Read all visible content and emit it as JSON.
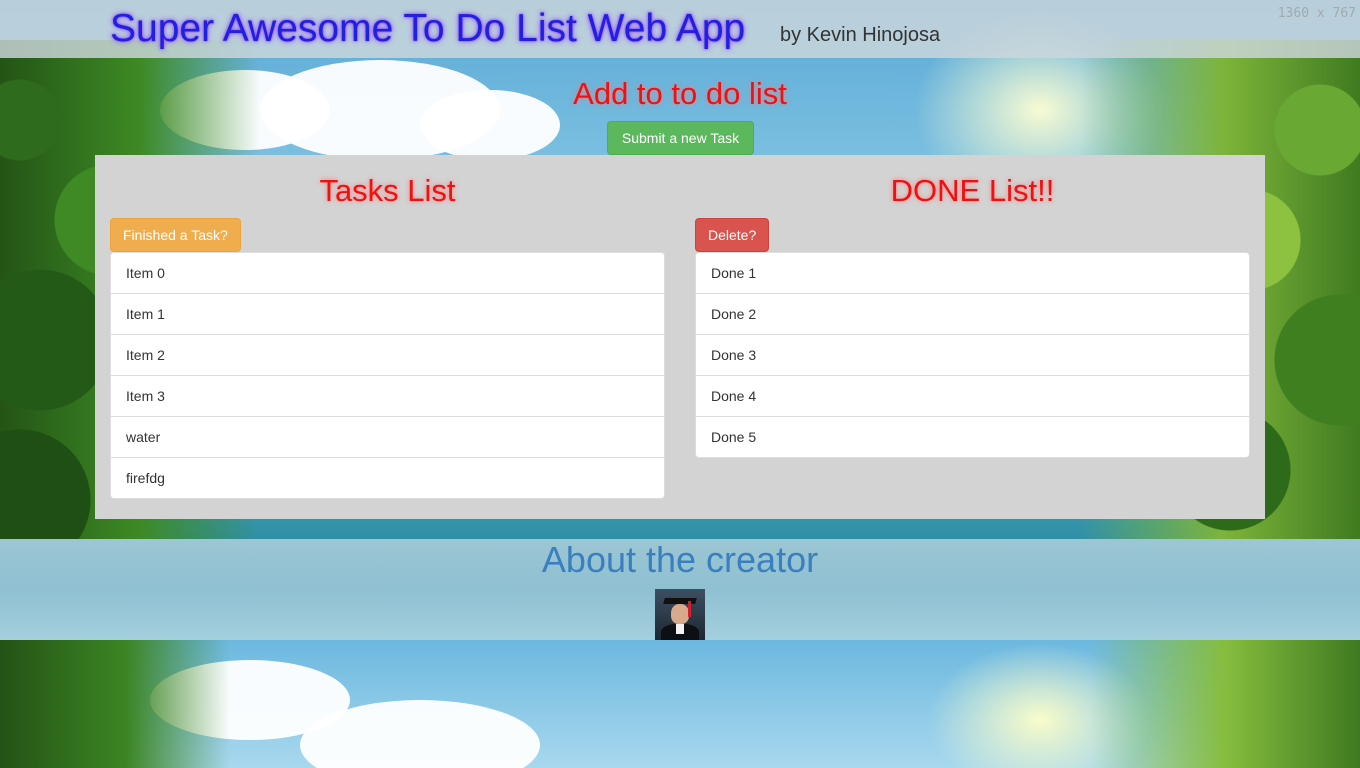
{
  "header": {
    "title": "Super Awesome To Do List Web App",
    "author": "by Kevin Hinojosa",
    "resolution_label": "1360 x 767"
  },
  "add_section": {
    "title": "Add to to do list",
    "submit_label": "Submit a new Task"
  },
  "tasks": {
    "title": "Tasks List",
    "button_label": "Finished a Task?",
    "items": [
      "Item 0",
      "Item 1",
      "Item 2",
      "Item 3",
      "water",
      "firefdg"
    ]
  },
  "done": {
    "title": "DONE List!!",
    "button_label": "Delete?",
    "items": [
      "Done 1",
      "Done 2",
      "Done 3",
      "Done 4",
      "Done 5"
    ]
  },
  "footer": {
    "title": "About the creator"
  },
  "colors": {
    "submit_button": "#5cb85c",
    "finish_button": "#f0ad4e",
    "delete_button": "#d9534f",
    "heading_red": "#ee1111",
    "title_blue": "#2020e0",
    "footer_title": "#3a7fc0",
    "panel_bg": "#d3d3d3"
  }
}
